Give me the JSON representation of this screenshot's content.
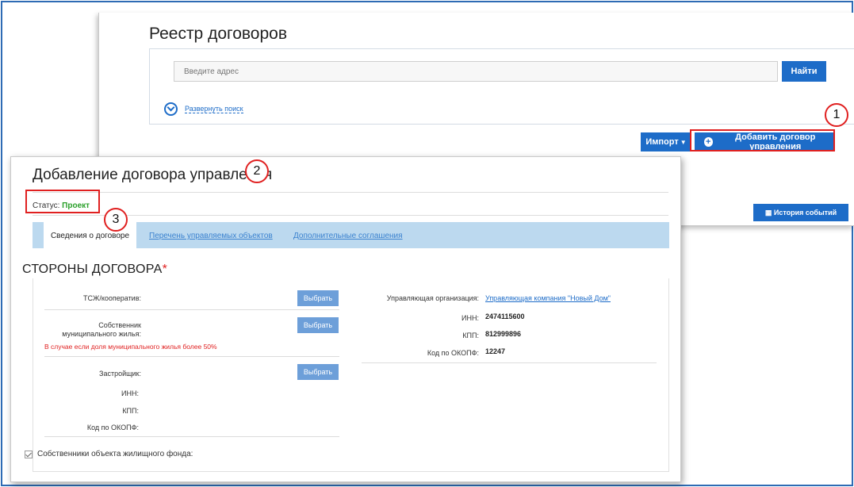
{
  "registry": {
    "title": "Реестр договоров",
    "search_placeholder": "Введите адрес",
    "find_label": "Найти",
    "expand_label": "Развернуть поиск",
    "import_label": "Импорт",
    "add_label": "Добавить договор управления",
    "history_label": "История событий"
  },
  "form": {
    "title": "Добавление договора управления",
    "status_label": "Статус:",
    "status_value": "Проект",
    "tabs": [
      {
        "label": "Сведения о договоре"
      },
      {
        "label": "Перечень управляемых объектов"
      },
      {
        "label": "Дополнительные соглашения"
      }
    ],
    "sides_title": "СТОРОНЫ ДОГОВОРА",
    "required_mark": "*",
    "left": {
      "hoa_label": "ТСЖ/кооператив:",
      "owner_label_1": "Собственник",
      "owner_label_2": "муниципального жилья:",
      "owner_note": "В случае если доля муниципального жилья более 50%",
      "developer_label": "Застройщик:",
      "inn_label": "ИНН:",
      "kpp_label": "КПП:",
      "okopf_label": "Код по ОКОПФ:",
      "choose_label": "Выбрать",
      "owners_checkbox_label": "Собственники объекта жилищного фонда:"
    },
    "right": {
      "org_label": "Управляющая организация:",
      "org_value": "Управляющая компания \"Новый Дом\"",
      "inn_label": "ИНН:",
      "inn_value": "2474115600",
      "kpp_label": "КПП:",
      "kpp_value": "812999896",
      "okopf_label": "Код по ОКОПФ:",
      "okopf_value": "12247"
    }
  },
  "annotations": [
    "1",
    "2",
    "3"
  ],
  "colors": {
    "primary": "#1d6cc8",
    "annotation": "#e02020",
    "status": "#2aa02a",
    "tabs_bg": "#bcd9ef"
  }
}
